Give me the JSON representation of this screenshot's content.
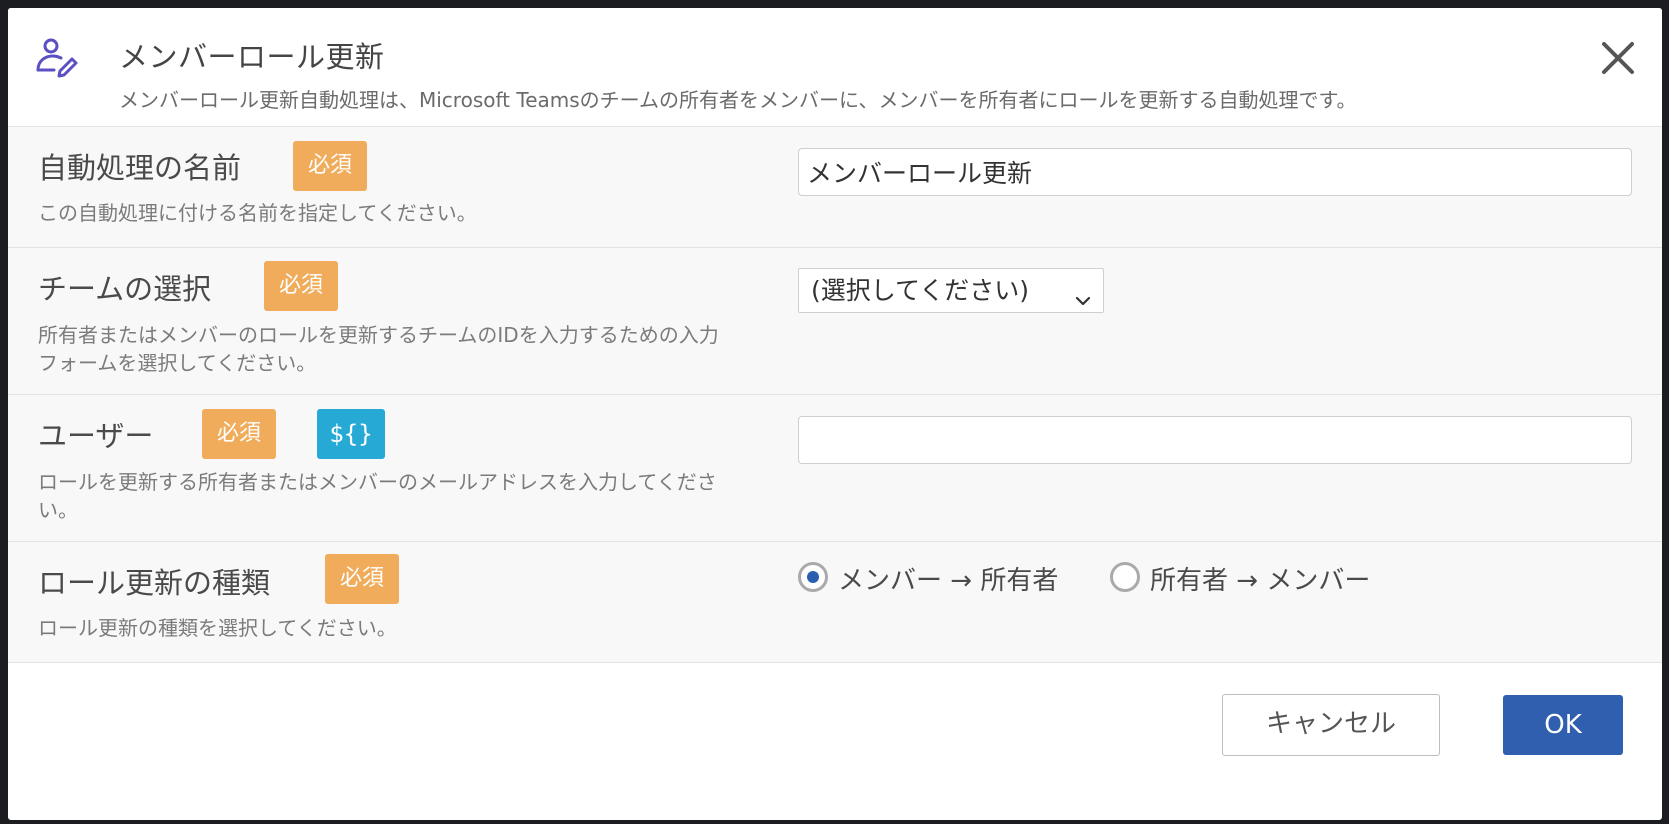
{
  "dialog": {
    "title": "メンバーロール更新",
    "description": "メンバーロール更新自動処理は、Microsoft Teamsのチームの所有者をメンバーに、メンバーを所有者にロールを更新する自動処理です。",
    "header_icon": "user-edit-icon",
    "close_icon": "close-icon"
  },
  "fields": {
    "name": {
      "label": "自動処理の名前",
      "required_badge": "必須",
      "description": "この自動処理に付ける名前を指定してください。",
      "value": "メンバーロール更新"
    },
    "team": {
      "label": "チームの選択",
      "required_badge": "必須",
      "description": "所有者またはメンバーのロールを更新するチームのIDを入力するための入力フォームを選択してください。",
      "selected": "(選択してください)"
    },
    "user": {
      "label": "ユーザー",
      "required_badge": "必須",
      "variable_badge": "${}",
      "description": "ロールを更新する所有者またはメンバーのメールアドレスを入力してください。",
      "value": ""
    },
    "role_type": {
      "label": "ロール更新の種類",
      "required_badge": "必須",
      "description": "ロール更新の種類を選択してください。",
      "options": [
        {
          "label": "メンバー → 所有者",
          "checked": true
        },
        {
          "label": "所有者 → メンバー",
          "checked": false
        }
      ]
    }
  },
  "footer": {
    "cancel_label": "キャンセル",
    "ok_label": "OK"
  },
  "colors": {
    "required_badge": "#f0ac5a",
    "variable_badge": "#27a9d6",
    "primary_button": "#2f5fae",
    "icon_accent": "#5b4fc4"
  }
}
